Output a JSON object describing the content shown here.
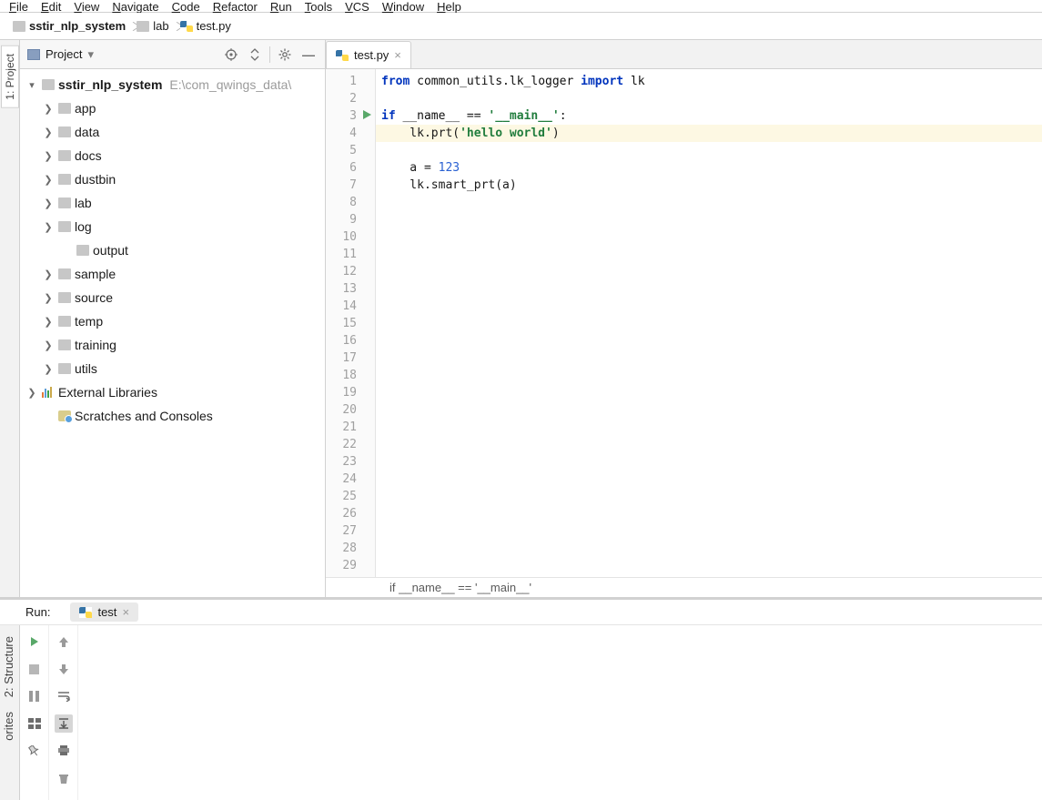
{
  "menu": [
    "File",
    "Edit",
    "View",
    "Navigate",
    "Code",
    "Refactor",
    "Run",
    "Tools",
    "VCS",
    "Window",
    "Help"
  ],
  "menuKeys": [
    "F",
    "E",
    "V",
    "N",
    "C",
    "R",
    "R",
    "T",
    "V",
    "W",
    "H"
  ],
  "breadcrumb": [
    {
      "icon": "folder",
      "label": "sstir_nlp_system",
      "bold": true
    },
    {
      "icon": "folder",
      "label": "lab"
    },
    {
      "icon": "py",
      "label": "test.py"
    }
  ],
  "leftTabs": [
    {
      "label": "1: Project",
      "selected": true
    }
  ],
  "bottomLeftTabs": [
    {
      "label": "2: Structure"
    },
    {
      "label": "orites"
    }
  ],
  "projectHeader": {
    "title": "Project",
    "dropdown": "▾"
  },
  "projectToolbar": [
    "target-icon",
    "collapse-icon",
    "gear-icon",
    "minimize-icon"
  ],
  "tree": [
    {
      "depth": 0,
      "tw": "v",
      "icon": "folder",
      "label": "sstir_nlp_system",
      "hint": "E:\\com_qwings_data\\",
      "bold": true
    },
    {
      "depth": 1,
      "tw": ">",
      "icon": "folder",
      "label": "app"
    },
    {
      "depth": 1,
      "tw": ">",
      "icon": "folder",
      "label": "data"
    },
    {
      "depth": 1,
      "tw": ">",
      "icon": "folder",
      "label": "docs"
    },
    {
      "depth": 1,
      "tw": ">",
      "icon": "folder",
      "label": "dustbin"
    },
    {
      "depth": 1,
      "tw": ">",
      "icon": "folder",
      "label": "lab"
    },
    {
      "depth": 1,
      "tw": ">",
      "icon": "folder",
      "label": "log"
    },
    {
      "depth": 2,
      "tw": "",
      "icon": "folder",
      "label": "output"
    },
    {
      "depth": 1,
      "tw": ">",
      "icon": "folder",
      "label": "sample"
    },
    {
      "depth": 1,
      "tw": ">",
      "icon": "folder",
      "label": "source"
    },
    {
      "depth": 1,
      "tw": ">",
      "icon": "folder",
      "label": "temp"
    },
    {
      "depth": 1,
      "tw": ">",
      "icon": "folder",
      "label": "training"
    },
    {
      "depth": 1,
      "tw": ">",
      "icon": "folder",
      "label": "utils"
    },
    {
      "depth": 0,
      "tw": ">",
      "icon": "lib",
      "label": "External Libraries"
    },
    {
      "depth": 0,
      "tw": "",
      "icon": "scratch",
      "label": "Scratches and Consoles",
      "indent": 1
    }
  ],
  "editorTabs": [
    {
      "icon": "py",
      "label": "test.py",
      "close": "×"
    }
  ],
  "gutter": {
    "from": 1,
    "to": 29,
    "runMarkAt": 3
  },
  "highlightLine": 4,
  "code": [
    {
      "n": 1,
      "html": "<span class='kw'>from</span> <span class='id'>common_utils.lk_logger</span> <span class='kw'>import</span> <span class='id'>lk</span>"
    },
    {
      "n": 2,
      "html": ""
    },
    {
      "n": 3,
      "html": "<span class='kw'>if</span> <span class='id'>__name__</span> == <span class='str'>'__main__'</span>:"
    },
    {
      "n": 4,
      "html": "    lk.prt(<span class='str'>'hello world'</span>)"
    },
    {
      "n": 5,
      "html": ""
    },
    {
      "n": 6,
      "html": "    a = <span class='num'>123</span>"
    },
    {
      "n": 7,
      "html": "    lk.smart_prt(a)"
    },
    {
      "n": 8,
      "html": ""
    }
  ],
  "crumbFooter": "if __name__ == '__main__'",
  "run": {
    "title": "Run:",
    "tab": "test",
    "leftCol": [
      "▶",
      "■",
      "‖",
      "≣",
      "📌"
    ],
    "rightCol": [
      "↑",
      "↓",
      "⇥",
      "⇲",
      "🖶",
      "🗑"
    ]
  }
}
